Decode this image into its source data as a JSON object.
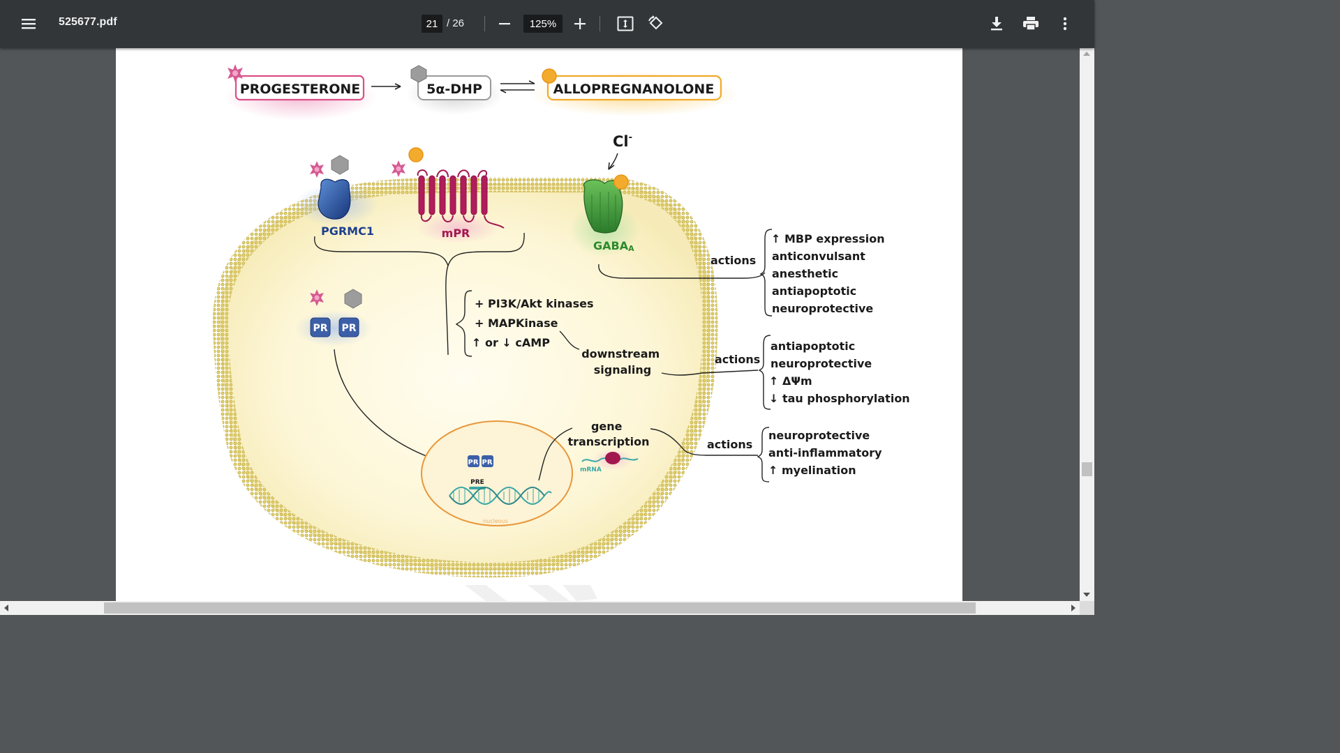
{
  "toolbar": {
    "menu_icon": "hamburger-menu-icon",
    "filename": "525677.pdf",
    "current_page": "21",
    "page_total": "/ 26",
    "zoom_level": "125%",
    "zoom_out_icon": "minus-icon",
    "zoom_in_icon": "plus-icon",
    "fit_icon": "fit-to-page-icon",
    "rotate_icon": "rotate-counterclockwise-icon",
    "download_icon": "download-icon",
    "print_icon": "print-icon",
    "more_icon": "more-vertical-icon",
    "background_color": "#323639"
  },
  "diagram": {
    "pathway": {
      "progesterone": "PROGESTERONE",
      "dhp": "5α-DHP",
      "allopregnanolone": "ALLOPREGNANOLONE"
    },
    "chloride": "Cl",
    "chloride_superscript": "-",
    "receptors": {
      "pgrmc1": "PGRMC1",
      "mpr": "mPR",
      "gaba": "GABA",
      "gaba_subscript": "A",
      "pr_left": "PR",
      "pr_right": "PR"
    },
    "kinases": [
      "+ PI3K/Akt kinases",
      "+ MAPKinase",
      "↑ or ↓ cAMP"
    ],
    "downstream": [
      "downstream",
      "signaling"
    ],
    "gene": [
      "gene",
      "transcription"
    ],
    "mrna": "mRNA",
    "pre": "PRE",
    "nucleus": "nucleous",
    "nucleus_pr": [
      "PR",
      "PR"
    ],
    "actions_label": "actions",
    "actions_gaba": [
      "↑ MBP expression",
      "anticonvulsant",
      "anesthetic",
      "antiapoptotic",
      "neuroprotective"
    ],
    "actions_signaling": [
      "antiapoptotic",
      "neuroprotective",
      "↑ ΔΨm",
      "↓ tau phosphorylation"
    ],
    "actions_transcription": [
      "neuroprotective",
      "anti-inflammatory",
      "↑ myelination"
    ],
    "colors": {
      "membrane": "#d8c45c",
      "cell_fill": "#fdf8df",
      "progesterone": "#c93f76",
      "dhp": "#8a8a8a",
      "allopregnanolone": "#f0a928",
      "pgrmc1": "#1f4fa0",
      "mpr": "#a3174f",
      "gaba": "#3c9c3c",
      "pr": "#3c5fa8",
      "nucleus": "#e8973a",
      "dna": "#3aa7a7"
    }
  }
}
